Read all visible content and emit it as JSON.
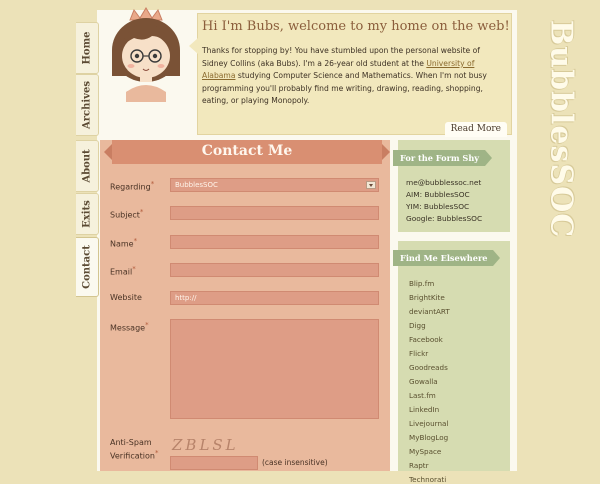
{
  "header": {
    "greeting": "Hi I'm Bubs, welcome to my home on the web!",
    "intro_before": "Thanks for stopping by! You have stumbled upon the personal website of Sidney Collins (aka Bubs). I'm a 26-year old student at the ",
    "intro_link": "University of Alabama",
    "intro_after": " studying Computer Science and Mathematics. When I'm not busy programming you'll probably find me writing, drawing, reading, shopping, eating, or playing Monopoly.",
    "read_more": "Read More"
  },
  "site_title": "BubblesSOC",
  "nav_tabs": [
    "Home",
    "Archives",
    "About",
    "Exits",
    "Contact"
  ],
  "contact": {
    "title": "Contact Me",
    "regarding_label": "Regarding",
    "regarding_value": "BubblesSOC",
    "subject_label": "Subject",
    "name_label": "Name",
    "email_label": "Email",
    "website_label": "Website",
    "website_value": "http://",
    "message_label": "Message",
    "antispam_label_1": "Anti-Spam",
    "antispam_label_2": "Verification",
    "captcha_text": "ZBLSL",
    "case_note": "(case insensitive)",
    "required_mark": "*"
  },
  "sidebar": {
    "form_shy_title": "For the Form Shy",
    "contacts": [
      "me@bubblessoc.net",
      "AIM: BubblesSOC",
      "YIM: BubblesSOC",
      "Google: BubblesSOC"
    ],
    "elsewhere_title": "Find Me Elsewhere",
    "links": [
      "Blip.fm",
      "BrightKite",
      "deviantART",
      "Digg",
      "Facebook",
      "Flickr",
      "Goodreads",
      "Gowalla",
      "Last.fm",
      "LinkedIn",
      "Livejournal",
      "MyBlogLog",
      "MySpace",
      "Raptr",
      "Technorati"
    ]
  },
  "colors": {
    "background": "#ece2b8",
    "contact_panel": "#e9b99d",
    "contact_ribbon": "#d98f72",
    "sidebar_card": "#d6dcb1",
    "sidebar_head": "#9fb486"
  }
}
